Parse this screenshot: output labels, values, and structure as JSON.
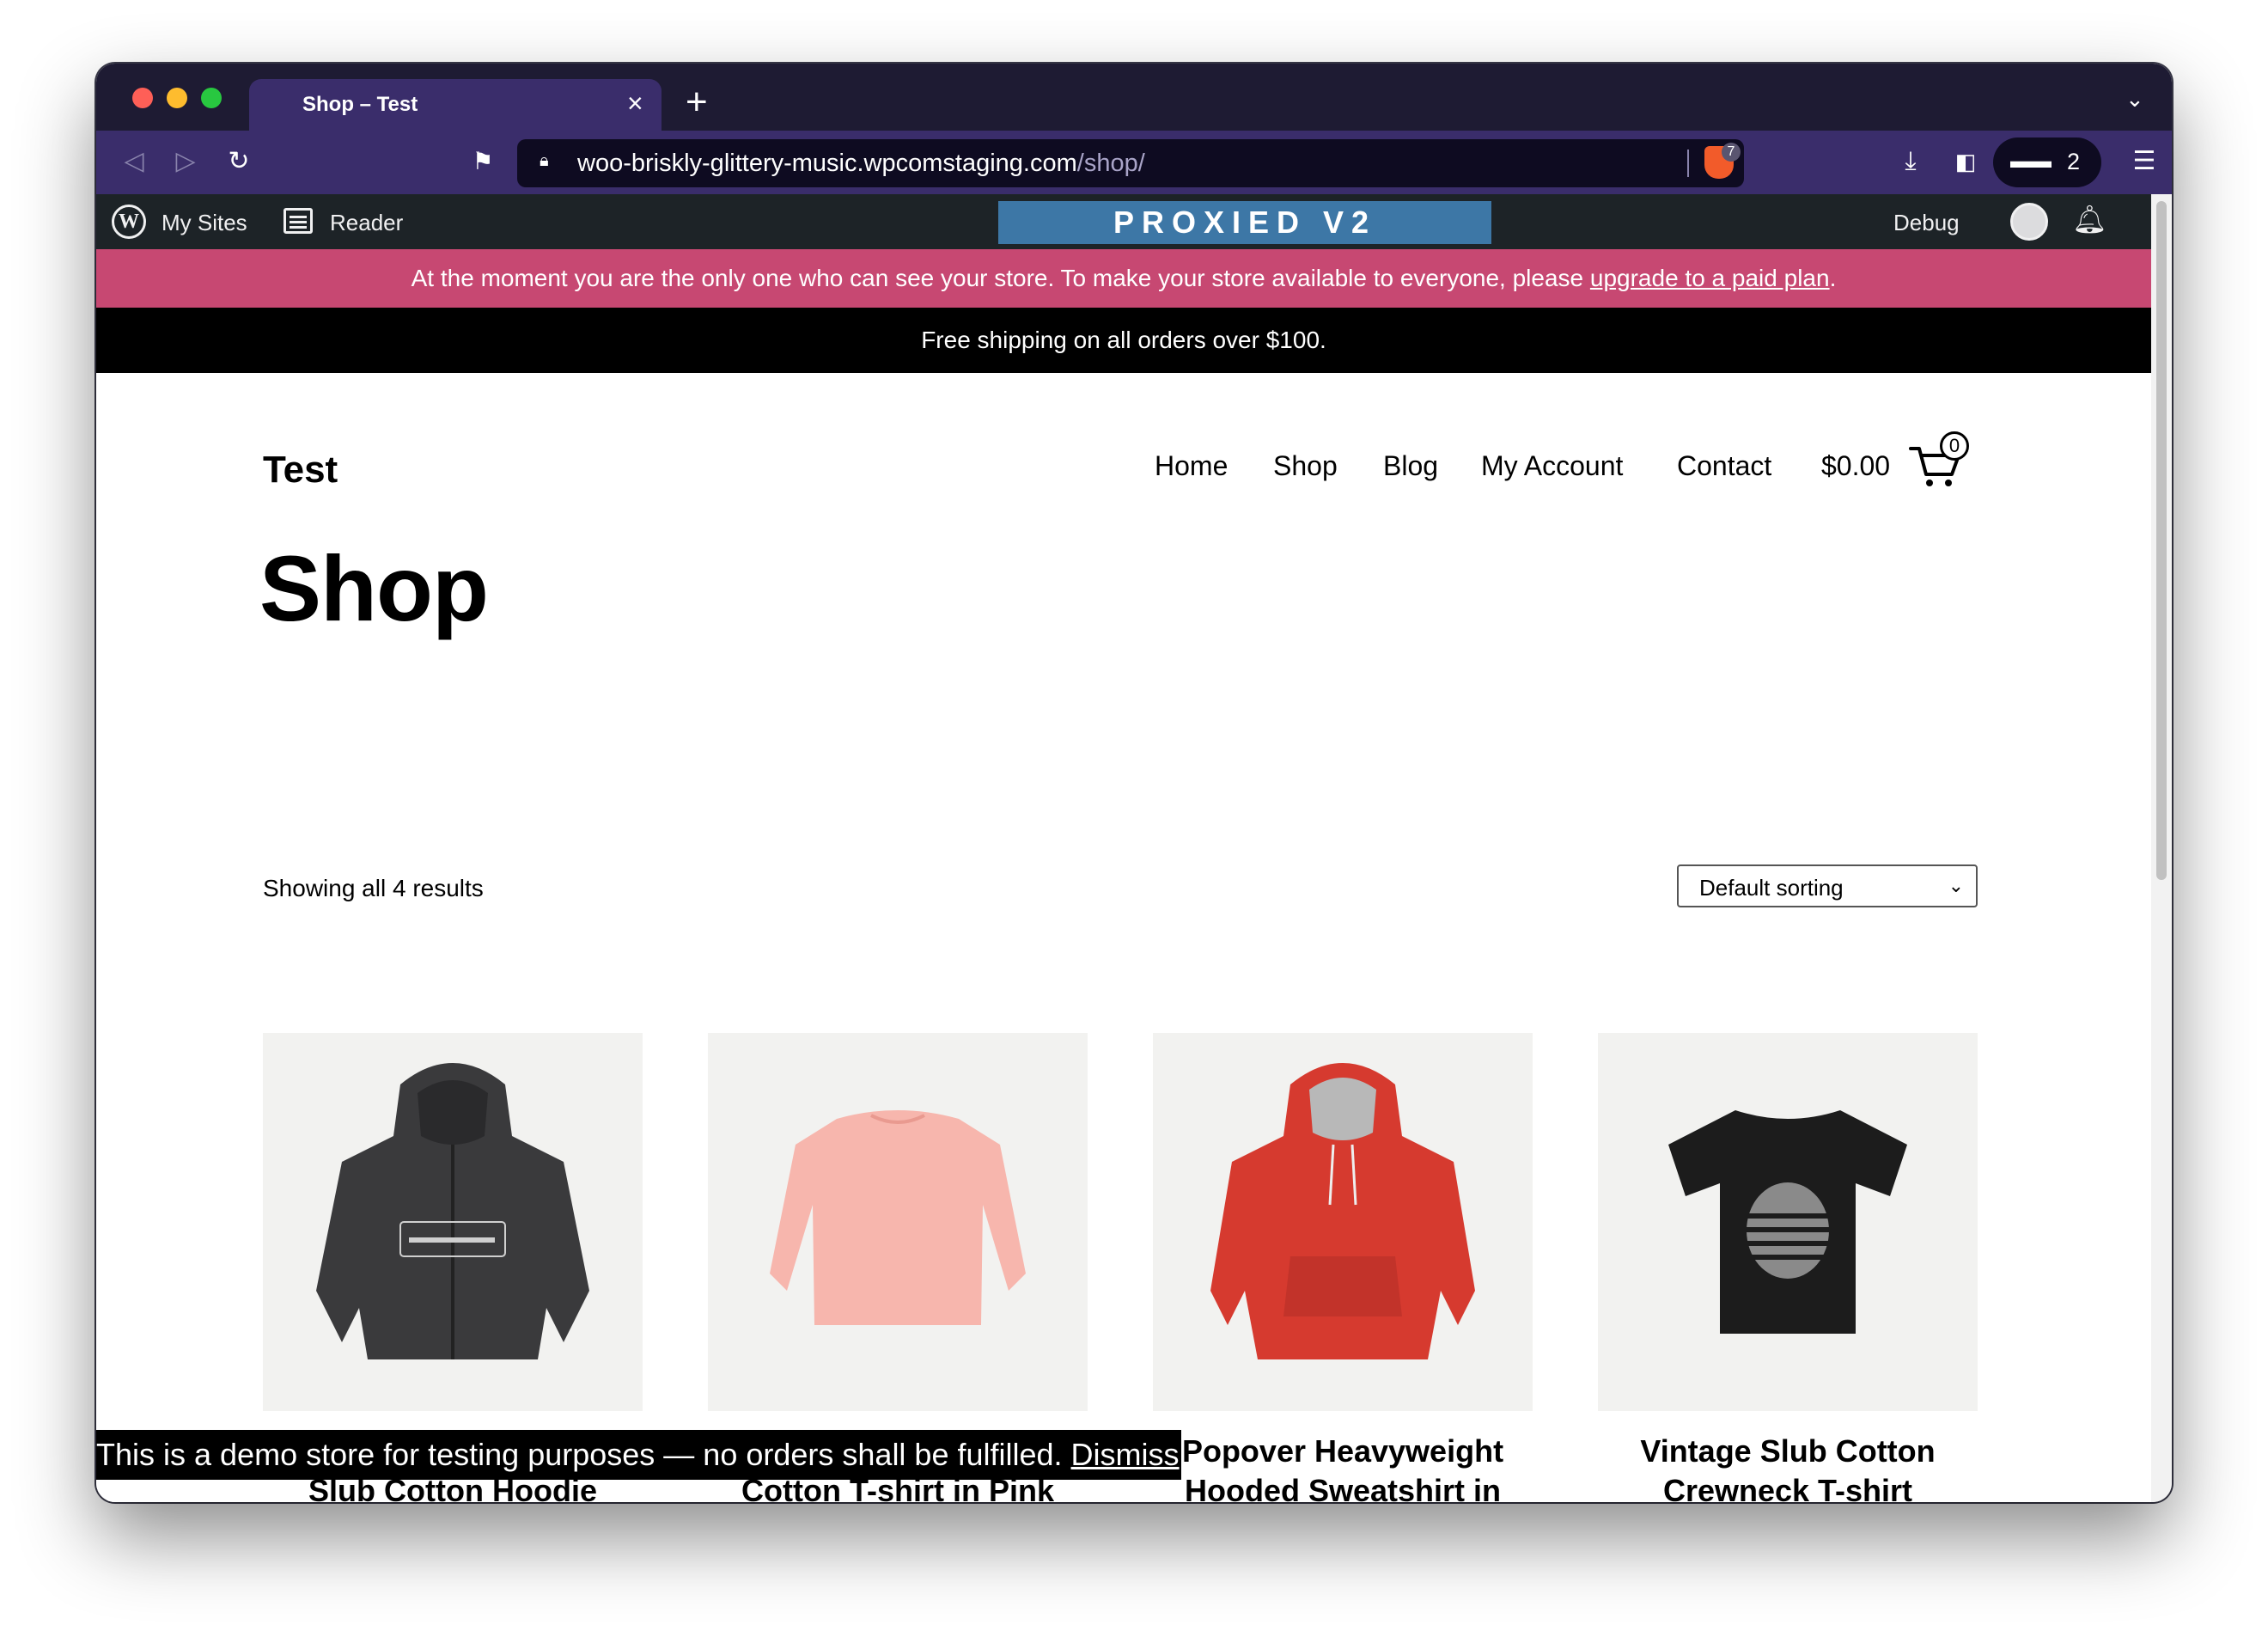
{
  "browser": {
    "tab_title": "Shop – Test",
    "tab_close": "×",
    "new_tab": "+",
    "url_host": "woo-briskly-glittery-music.wpcomstaging.com",
    "url_path": "/shop/",
    "shields_count": "7",
    "wallet_count": "2"
  },
  "admin_bar": {
    "my_sites": "My Sites",
    "reader": "Reader",
    "proxied": "PROXIED V2",
    "debug": "Debug"
  },
  "notices": {
    "private_text": "At the moment you are the only one who can see your store. To make your store available to everyone, please ",
    "private_link": "upgrade to a paid plan",
    "private_end": ".",
    "shipping": "Free shipping on all orders over $100.",
    "demo_text": "This is a demo store for testing purposes — no orders shall be fulfilled. ",
    "demo_dismiss": "Dismiss"
  },
  "site": {
    "title": "Test",
    "nav": [
      "Home",
      "Shop",
      "Blog",
      "My Account",
      "Contact"
    ],
    "cart_total": "$0.00",
    "cart_count": "0"
  },
  "shop": {
    "page_title": "Shop",
    "result_count": "Showing all 4 results",
    "sorting_selected": "Default sorting"
  },
  "products": [
    {
      "title": "Garment-dyed Super Soft Slub Cotton Hoodie",
      "color": "#3a3a3c"
    },
    {
      "title": "Long-sleeve Vintage Cotton T-shirt in Pink",
      "color": "#f7b6ad"
    },
    {
      "title": "Popover Heavyweight Hooded Sweatshirt in Red",
      "color": "#d63a2f"
    },
    {
      "title": "Vintage Slub Cotton Crewneck T-shirt",
      "color": "#1c1c1c"
    }
  ],
  "colors": {
    "tab_strip": "#1e1b33",
    "toolbar": "#3a2d6b",
    "admin_bar": "#1d2327",
    "proxied": "#3d77a6",
    "notice_pink": "#c74872"
  }
}
